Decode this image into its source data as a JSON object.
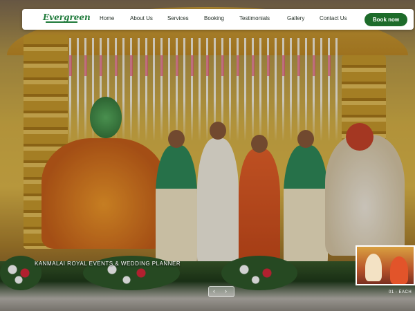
{
  "brand": {
    "logo_text": "Evergreen"
  },
  "nav": {
    "links": [
      "Home",
      "About Us",
      "Services",
      "Booking",
      "Testimonials",
      "Gallery",
      "Contact Us"
    ],
    "cta_label": "Book now"
  },
  "hero": {
    "caption": "KANMALAI ROYAL EVENTS & WEDDING PLANNER",
    "prev_icon": "chevron-left-icon",
    "next_icon": "chevron-right-icon",
    "slide_counter": "01 - EACH"
  },
  "colors": {
    "accent": "#1d6b2a",
    "navbar_bg": "#ffffff"
  }
}
